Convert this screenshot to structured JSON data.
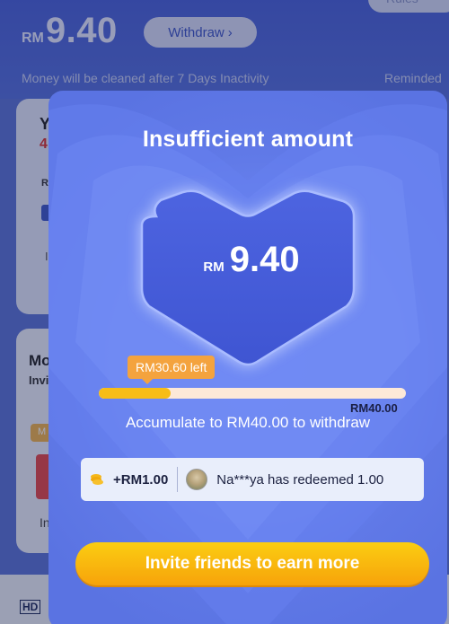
{
  "background": {
    "balance": {
      "currency": "RM",
      "amount": "9.40"
    },
    "withdraw_button": {
      "label": "Withdraw",
      "icon": "chevron-right-icon"
    },
    "rules_button": {
      "label": "Rules"
    },
    "notice": "Money will be cleaned after 7 Days Inactivity",
    "reminded": "Reminded",
    "card1": {
      "title": "Y",
      "value": "4",
      "label": "R",
      "footer": "I"
    },
    "card2": {
      "title": "Mo",
      "subtitle": "Invi",
      "tag": "M",
      "footer": "In"
    },
    "logo": "HD"
  },
  "modal": {
    "title": "Insufficient amount",
    "heart_amount": {
      "currency": "RM",
      "amount": "9.40"
    },
    "tooltip": "RM30.60 left",
    "progress": {
      "current": 9.4,
      "target": 40.0,
      "fraction": 0.235
    },
    "target_label": "RM40.00",
    "accumulate_text": "Accumulate to RM40.00 to withdraw",
    "redeem": {
      "coin_icon": "coin-stack-icon",
      "reward": "+RM1.00",
      "message": "Na***ya has redeemed 1.00"
    },
    "invite_button": "Invite friends to earn more"
  },
  "colors": {
    "modal_bg": "#6079e7",
    "heart": "#4a60dc",
    "progress_fill": "#f7bd17",
    "progress_track": "#fde9d8",
    "tooltip": "#f4a33e",
    "button": "#f9b90e"
  }
}
